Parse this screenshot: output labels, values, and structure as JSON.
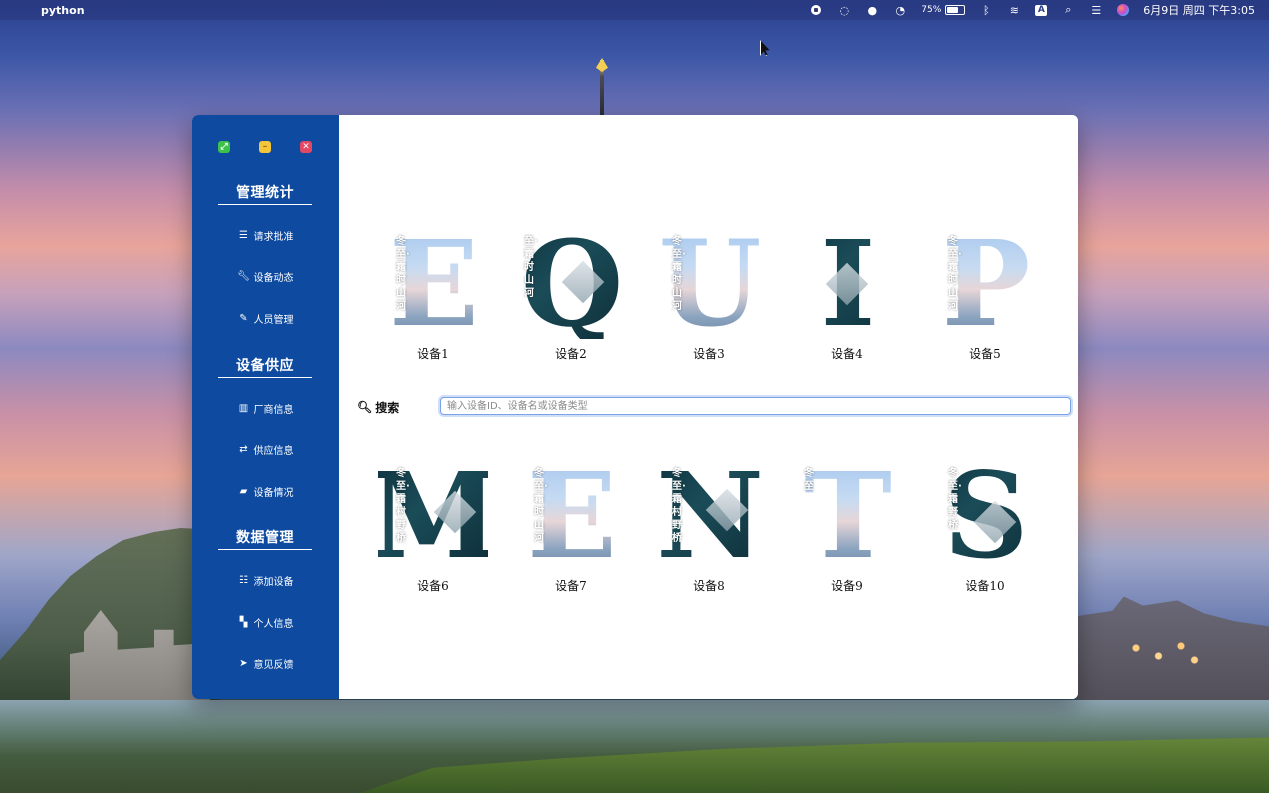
{
  "menubar": {
    "app_name": "python",
    "battery_percent": "75%",
    "input_method": "A",
    "clock": "6月9日 周四 下午3:05"
  },
  "sidebar": {
    "sections": [
      {
        "title": "管理统计",
        "items": [
          {
            "label": "请求批准",
            "icon": "list-icon"
          },
          {
            "label": "设备动态",
            "icon": "wrench-icon"
          },
          {
            "label": "人员管理",
            "icon": "edit-icon"
          }
        ]
      },
      {
        "title": "设备供应",
        "items": [
          {
            "label": "厂商信息",
            "icon": "bar-chart-icon"
          },
          {
            "label": "供应信息",
            "icon": "exchange-icon"
          },
          {
            "label": "设备情况",
            "icon": "folder-icon"
          }
        ]
      },
      {
        "title": "数据管理",
        "items": [
          {
            "label": "添加设备",
            "icon": "list-ul-icon"
          },
          {
            "label": "个人信息",
            "icon": "map-icon"
          },
          {
            "label": "意见反馈",
            "icon": "send-icon"
          }
        ]
      }
    ]
  },
  "devices_top": [
    {
      "letter": "E",
      "label": "设备1",
      "style": "sky",
      "overlay": "冬至·霜时山河"
    },
    {
      "letter": "Q",
      "label": "设备2",
      "style": "dark",
      "overlay": "至·霜时山河"
    },
    {
      "letter": "U",
      "label": "设备3",
      "style": "sky",
      "overlay": "冬至·霜时山河"
    },
    {
      "letter": "I",
      "label": "设备4",
      "style": "dark",
      "overlay": ""
    },
    {
      "letter": "P",
      "label": "设备5",
      "style": "sky",
      "overlay": "冬至·霜时山河"
    }
  ],
  "devices_bottom": [
    {
      "letter": "M",
      "label": "设备6",
      "style": "dark",
      "overlay": "冬至·霜村野桥"
    },
    {
      "letter": "E",
      "label": "设备7",
      "style": "sky",
      "overlay": "冬至·霜时山河"
    },
    {
      "letter": "N",
      "label": "设备8",
      "style": "dark",
      "overlay": "冬至·霜村野桥"
    },
    {
      "letter": "T",
      "label": "设备9",
      "style": "sky",
      "overlay": "冬至"
    },
    {
      "letter": "S",
      "label": "设备10",
      "style": "dark",
      "overlay": "冬至·霜野桥"
    }
  ],
  "search": {
    "label": "搜索",
    "placeholder": "输入设备ID、设备名或设备类型",
    "value": ""
  },
  "colors": {
    "sidebar_bg": "#0d4aa0",
    "traffic_green": "#3cc24a",
    "traffic_yellow": "#f2c53b",
    "traffic_red": "#e34862"
  }
}
